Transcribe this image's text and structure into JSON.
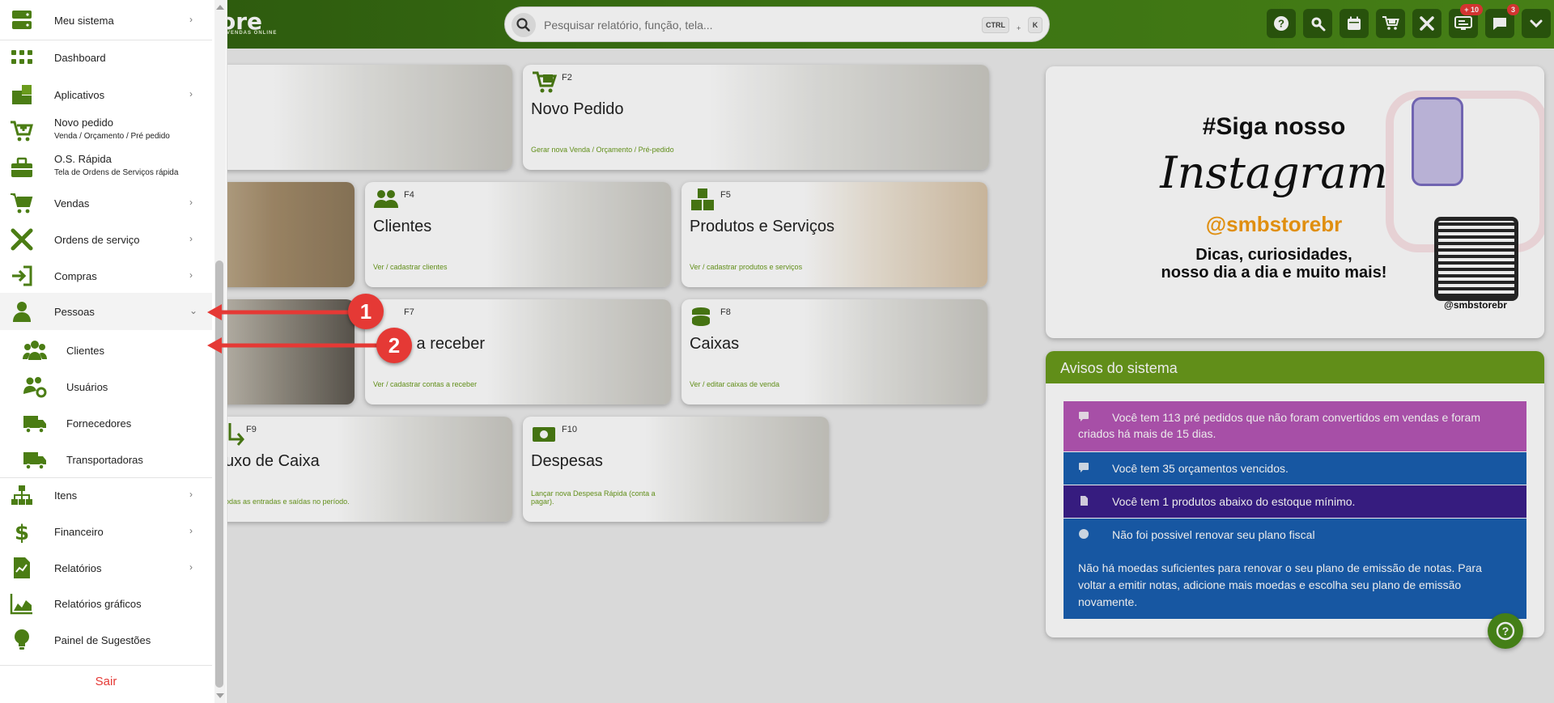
{
  "header": {
    "brand": "ore",
    "brand_sub": "VENDAS ONLINE",
    "search_placeholder": "Pesquisar relatório, função, tela...",
    "kbd_ctrl": "CTRL",
    "kbd_plus": "+",
    "kbd_k": "K",
    "badges": {
      "notifications": "+ 10",
      "messages": "3"
    }
  },
  "tiles": [
    {
      "key": "F2",
      "title": "Novo Pedido",
      "sub": "Gerar nova Venda / Orçamento / Pré-pedido"
    },
    {
      "key": "F4",
      "title": "Clientes",
      "sub": "Ver / cadastrar clientes"
    },
    {
      "key": "F5",
      "title": "Produtos e Serviços",
      "sub": "Ver / cadastrar produtos e serviços"
    },
    {
      "key": "F7",
      "title": "s a receber",
      "sub": "Ver / cadastrar contas a receber"
    },
    {
      "key": "F8",
      "title": "Caixas",
      "sub": "Ver / editar caixas de venda"
    },
    {
      "key": "F9",
      "title": "uxo de Caixa",
      "sub": "odas as entradas e saídas no período."
    },
    {
      "key": "F10",
      "title": "Despesas",
      "sub": "Lançar nova Despesa Rápida (conta a pagar)."
    }
  ],
  "instagram": {
    "line1": "#Siga nosso",
    "line2": "Instagram",
    "handle": "@smbstorebr",
    "tagline1": "Dicas, curiosidades,",
    "tagline2": "nosso dia a dia e muito mais!",
    "qr_label": "@smbstorebr"
  },
  "avisos": {
    "title": "Avisos do sistema",
    "items": [
      {
        "text": "Você tem 113 pré pedidos que não foram convertidos em vendas e foram criados há mais de 15 dias.",
        "color": "#b656b6"
      },
      {
        "text": "Você tem 35 orçamentos vencidos.",
        "color": "#1a5fb0"
      },
      {
        "text": "Você tem 1 produtos abaixo do estoque mínimo.",
        "color": "#3b1f8a"
      },
      {
        "text": "Não foi possivel renovar seu plano fiscal",
        "color": "#1a5fb0"
      },
      {
        "text": "Não há moedas suficientes para renovar o seu plano de emissão de notas. Para voltar a emitir notas, adicione mais moedas e escolha seu plano de emissão novamente.",
        "color": "#1a5fb0"
      }
    ]
  },
  "sidebar": {
    "items": [
      {
        "label": "Meu sistema"
      },
      {
        "label": "Dashboard"
      },
      {
        "label": "Aplicativos"
      },
      {
        "label": "Novo pedido",
        "sub": "Venda / Orçamento / Pré pedido"
      },
      {
        "label": "O.S. Rápida",
        "sub": "Tela de Ordens de Serviços rápida"
      },
      {
        "label": "Vendas"
      },
      {
        "label": "Ordens de serviço"
      },
      {
        "label": "Compras"
      },
      {
        "label": "Pessoas"
      },
      {
        "label": "Clientes"
      },
      {
        "label": "Usuários"
      },
      {
        "label": "Fornecedores"
      },
      {
        "label": "Transportadoras"
      },
      {
        "label": "Itens"
      },
      {
        "label": "Financeiro"
      },
      {
        "label": "Relatórios"
      },
      {
        "label": "Relatórios gráficos"
      },
      {
        "label": "Painel de Sugestões"
      }
    ],
    "logout": "Sair"
  },
  "annotations": {
    "one": "1",
    "two": "2"
  },
  "colors": {
    "green_dark": "#2d5a0f",
    "green": "#6a9b1c",
    "icon_green": "#4b7d14",
    "red": "#e53935"
  }
}
